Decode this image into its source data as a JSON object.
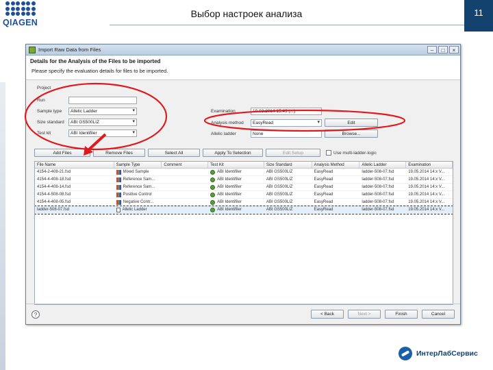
{
  "slide": {
    "logo_text": "QIAGEN",
    "title": "Выбор настроек анализа",
    "page_number": "11",
    "brand": "ИнтерЛабСервис"
  },
  "dialog": {
    "title": "Import Raw Data from Files",
    "header_bold": "Details for the Analysis of the Files to be imported",
    "header_sub": "Please specify the evaluation details for files to be imported.",
    "form": {
      "prompt_label": "Project",
      "run_label": "Run",
      "run_value": "",
      "sample_type_label": "Sample type",
      "sample_type_value": "Allelic Ladder",
      "size_standard_label": "Size standard",
      "size_standard_value": "ABI GS500LIZ",
      "test_kit_label": "Test kit",
      "test_kit_value": "ABI Identifiler",
      "exam_time_label": "Examination",
      "exam_time_value": "19.03.2014 15:49 (...)",
      "analysis_method_label": "Analysis method",
      "analysis_method_value": "EasyRead",
      "edit_label": "Edit",
      "allelic_ladder_label": "Allelic ladder",
      "allelic_ladder_value": "None",
      "browse_label": "Browse..."
    },
    "toolbar": {
      "add_files": "Add Files",
      "remove_files": "Remove Files",
      "select_all": "Select All",
      "apply_selection": "Apply To Selection",
      "edit_setup": "Edit Setup",
      "multi_ladder_label": "Use multi-ladder-logic"
    },
    "table": {
      "columns": [
        "File Name",
        "Sample Type",
        "Comment",
        "Test Kit",
        "Size Standard",
        "Analysis Method",
        "Allelic Ladder",
        "Examination"
      ],
      "rows": [
        {
          "file": "4154-2-408-21.fsd",
          "type": "Mixed Sample",
          "type_icon": "sample",
          "comment": "",
          "kit": "ABI Identifiler",
          "size": "ABI GS500LIZ",
          "method": "EasyRead",
          "ladder": "ladder-508-07.fsd",
          "exam": "19.05.2014 14:x V..."
        },
        {
          "file": "4154-4-408-18.fsd",
          "type": "Reference Sam...",
          "type_icon": "sample",
          "comment": "",
          "kit": "ABI Identifiler",
          "size": "ABI GS500LIZ",
          "method": "EasyRead",
          "ladder": "ladder-508-07.fsd",
          "exam": "19.05.2014 14:x V..."
        },
        {
          "file": "4154-4-408-14.fsd",
          "type": "Reference Sam...",
          "type_icon": "sample",
          "comment": "",
          "kit": "ABI Identifiler",
          "size": "ABI GS500LIZ",
          "method": "EasyRead",
          "ladder": "ladder-508-07.fsd",
          "exam": "19.05.2014 14:x V..."
        },
        {
          "file": "4154-4-508-08.fsd",
          "type": "Positive Control",
          "type_icon": "sample",
          "comment": "",
          "kit": "ABI Identifiler",
          "size": "ABI GS500LIZ",
          "method": "EasyRead",
          "ladder": "ladder-508-07.fsd",
          "exam": "19.05.2014 14:x V..."
        },
        {
          "file": "4154-4-408-05.fsd",
          "type": "Negative Contr...",
          "type_icon": "sample",
          "comment": "",
          "kit": "ABI Identifiler",
          "size": "ABI GS500LIZ",
          "method": "EasyRead",
          "ladder": "ladder-508-07.fsd",
          "exam": "19.05.2014 14:x V..."
        },
        {
          "file": "ladder-508-07.fsd",
          "type": "Allelic Ladder",
          "type_icon": "doc",
          "comment": "",
          "kit": "ABI Identifiler",
          "size": "ABI GS500LIZ",
          "method": "EasyRead",
          "ladder": "ladder-508-07.fsd",
          "exam": "19.05.2014 14:x V..."
        }
      ]
    },
    "footer": {
      "back": "< Back",
      "next": "Next >",
      "finish": "Finish",
      "cancel": "Cancel"
    }
  },
  "colors": {
    "annotation": "#e0191e",
    "accent": "#14426e"
  }
}
